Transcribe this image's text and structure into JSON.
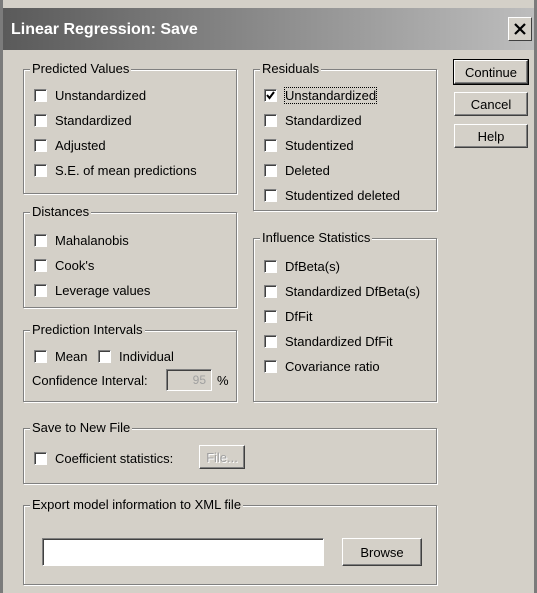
{
  "window": {
    "title": "Linear Regression: Save"
  },
  "buttons": {
    "continue": "Continue",
    "cancel": "Cancel",
    "help": "Help",
    "file": "File...",
    "browse": "Browse"
  },
  "predicted_values": {
    "legend": "Predicted Values",
    "items": [
      {
        "label": "Unstandardized",
        "checked": false
      },
      {
        "label": "Standardized",
        "checked": false
      },
      {
        "label": "Adjusted",
        "checked": false
      },
      {
        "label": "S.E. of mean predictions",
        "checked": false
      }
    ]
  },
  "distances": {
    "legend": "Distances",
    "items": [
      {
        "label": "Mahalanobis",
        "checked": false
      },
      {
        "label": "Cook's",
        "checked": false
      },
      {
        "label": "Leverage values",
        "checked": false
      }
    ]
  },
  "prediction_intervals": {
    "legend": "Prediction Intervals",
    "mean": "Mean",
    "individual": "Individual",
    "confidence_label": "Confidence Interval:",
    "confidence_value": "95",
    "percent": "%"
  },
  "residuals": {
    "legend": "Residuals",
    "items": [
      {
        "label": "Unstandardized",
        "checked": true
      },
      {
        "label": "Standardized",
        "checked": false
      },
      {
        "label": "Studentized",
        "checked": false
      },
      {
        "label": "Deleted",
        "checked": false
      },
      {
        "label": "Studentized deleted",
        "checked": false
      }
    ]
  },
  "influence_statistics": {
    "legend": "Influence Statistics",
    "items": [
      {
        "label": "DfBeta(s)",
        "checked": false
      },
      {
        "label": "Standardized DfBeta(s)",
        "checked": false
      },
      {
        "label": "DfFit",
        "checked": false
      },
      {
        "label": "Standardized DfFit",
        "checked": false
      },
      {
        "label": "Covariance ratio",
        "checked": false
      }
    ]
  },
  "save_to_new_file": {
    "legend": "Save to New File",
    "coefficient_label": "Coefficient statistics:"
  },
  "export_xml": {
    "legend": "Export model information to XML file",
    "path_value": ""
  }
}
